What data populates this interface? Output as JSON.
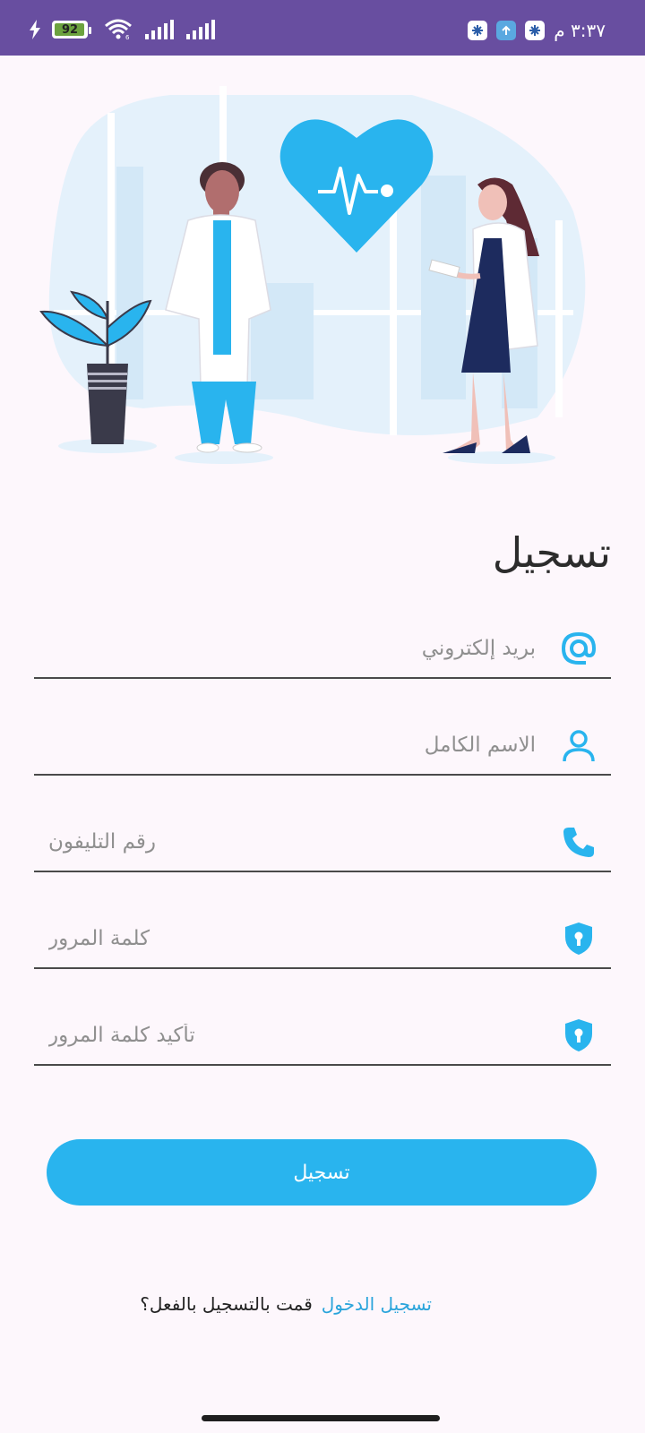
{
  "status_bar": {
    "battery_level": "92",
    "time": "٣:٣٧ م"
  },
  "colors": {
    "status_bar": "#684ea0",
    "accent": "#29b4ee",
    "background": "#fdf7fc",
    "link": "#29a4db"
  },
  "page": {
    "title": "تسجيل"
  },
  "form": {
    "email": {
      "placeholder": "بريد إلكتروني",
      "value": "",
      "icon": "at-icon"
    },
    "full_name": {
      "placeholder": "الاسم الكامل",
      "value": "",
      "icon": "person-icon"
    },
    "phone": {
      "placeholder": "رقم التليفون",
      "value": "",
      "icon": "phone-icon"
    },
    "password": {
      "placeholder": "كلمة المرور",
      "value": "",
      "icon": "shield-lock-icon"
    },
    "confirm_password": {
      "placeholder": "تأكيد كلمة المرور",
      "value": "",
      "icon": "shield-lock-icon"
    },
    "submit_label": "تسجيل"
  },
  "footer": {
    "question": "قمت بالتسجيل بالفعل؟",
    "login_link": "تسجيل الدخول"
  }
}
